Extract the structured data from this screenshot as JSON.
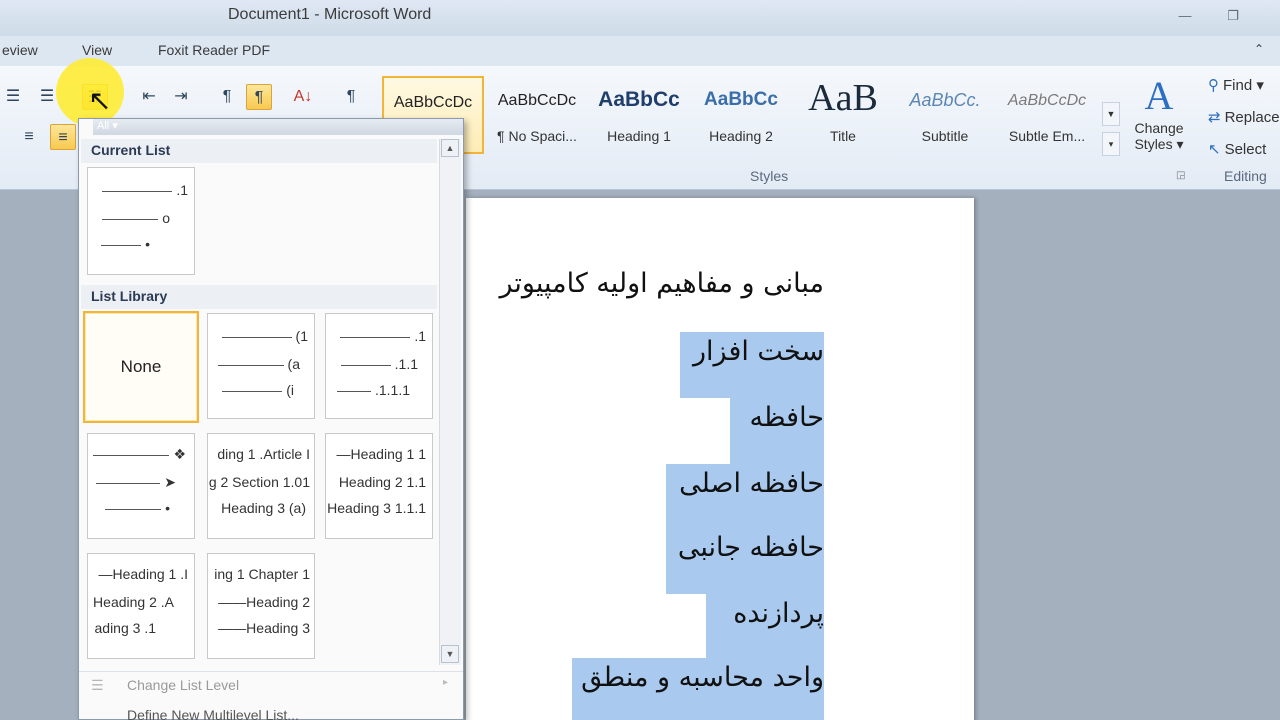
{
  "window": {
    "title": "Document1 - Microsoft Word",
    "controls": [
      "—",
      "❐"
    ]
  },
  "menu_tabs": [
    "eview",
    "View",
    "Foxit Reader PDF"
  ],
  "ribbon": {
    "paragraph_buttons": [
      "☰",
      "☰",
      "☷",
      "⇤",
      "⇥",
      "¶",
      "A↓",
      "¶"
    ],
    "align_buttons": [
      "≡",
      "≡"
    ],
    "styles": [
      {
        "preview": "AaBbCcDc",
        "name": "",
        "selected": true
      },
      {
        "preview": "AaBbCcDc",
        "name": "¶ No Spaci...",
        "selected": false
      },
      {
        "preview": "AaBbCc",
        "name": "Heading 1",
        "selected": false
      },
      {
        "preview": "AaBbCc",
        "name": "Heading 2",
        "selected": false
      },
      {
        "preview": "AaB",
        "name": "Title",
        "selected": false
      },
      {
        "preview": "AaBbCc.",
        "name": "Subtitle",
        "selected": false
      },
      {
        "preview": "AaBbCcDc",
        "name": "Subtle Em...",
        "selected": false
      }
    ],
    "change_styles": {
      "label1": "Change",
      "label2": "Styles ▾"
    },
    "groups": {
      "styles": "Styles",
      "editing": "Editing"
    },
    "editing": {
      "find": "Find ▾",
      "replace": "Replace",
      "select": "Select"
    }
  },
  "dropdown": {
    "filter": "All ▾",
    "current_list_title": "Current List",
    "list_library_title": "List Library",
    "current_list_lines": [
      ".1",
      "o",
      "•"
    ],
    "library": {
      "none": "None",
      "paren": [
        "(1",
        "(a",
        "(i"
      ],
      "numbered": [
        ".1",
        ".1.1",
        ".1.1.1"
      ],
      "bullets": [
        "❖",
        "➤",
        "•"
      ],
      "article": [
        "ding 1 .Article I",
        "g 2 Section 1.01",
        "Heading 3 (a)"
      ],
      "heading_numbered": [
        "—Heading 1 1",
        "Heading 2 1.1",
        "Heading 3 1.1.1"
      ],
      "heading_roman": [
        "—Heading 1 .I",
        "Heading 2 .A",
        "ading 3 .1"
      ],
      "chapter": [
        "ing 1 Chapter 1",
        "——Heading 2",
        "——Heading 3"
      ]
    },
    "commands": {
      "change_level": "Change List Level",
      "define_new": "Define New Multilevel List..."
    }
  },
  "document": {
    "heading": "مبانی و مفاهیم اولیه کامپیوتر",
    "lines": [
      "سخت افزار",
      "حافظه",
      "حافظه اصلی",
      "حافظه جانبی",
      "پردازنده",
      "واحد محاسبه و منطق"
    ]
  }
}
